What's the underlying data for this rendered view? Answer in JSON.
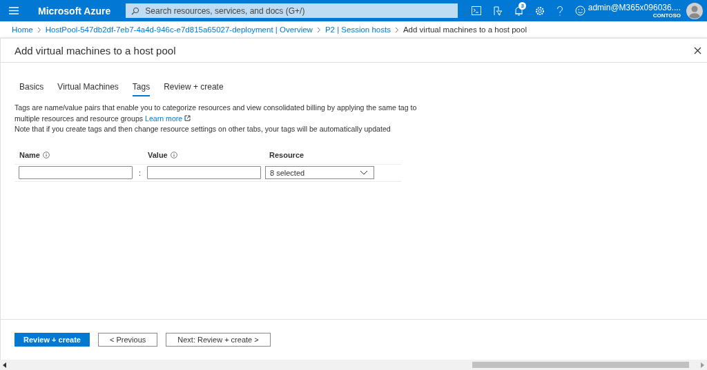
{
  "topbar": {
    "brand": "Microsoft Azure",
    "search": {
      "placeholder": "Search resources, services, and docs (G+/)"
    },
    "notification_count": "3",
    "user": {
      "name": "admin@M365x096036....",
      "tenant": "CONTOSO"
    }
  },
  "breadcrumb": [
    "Home",
    "HostPool-547db2df-7eb7-4a4d-946c-e7d815a65027-deployment | Overview",
    "P2 | Session hosts",
    "Add virtual machines to a host pool"
  ],
  "blade": {
    "title": "Add virtual machines to a host pool"
  },
  "tabs": [
    {
      "label": "Basics",
      "selected": false
    },
    {
      "label": "Virtual Machines",
      "selected": false
    },
    {
      "label": "Tags",
      "selected": true
    },
    {
      "label": "Review + create",
      "selected": false
    }
  ],
  "description": {
    "text": "Tags are name/value pairs that enable you to categorize resources and view consolidated billing by applying the same tag to multiple resources and resource groups",
    "link": "Learn more",
    "note": "Note that if you create tags and then change resource settings on other tabs, your tags will be automatically updated"
  },
  "tags_table": {
    "columns": [
      {
        "label": "Name",
        "info": true
      },
      {
        "label": "Value",
        "info": true
      },
      {
        "label": "Resource",
        "info": false
      }
    ],
    "rows": [
      {
        "name": "",
        "separator": ":",
        "value": "",
        "resource": "8 selected"
      }
    ]
  },
  "footer": {
    "buttons": [
      {
        "label": "Review + create",
        "kind": "primary"
      },
      {
        "label": "< Previous",
        "kind": "secondary"
      },
      {
        "label": "Next: Review + create >",
        "kind": "secondary"
      }
    ]
  }
}
